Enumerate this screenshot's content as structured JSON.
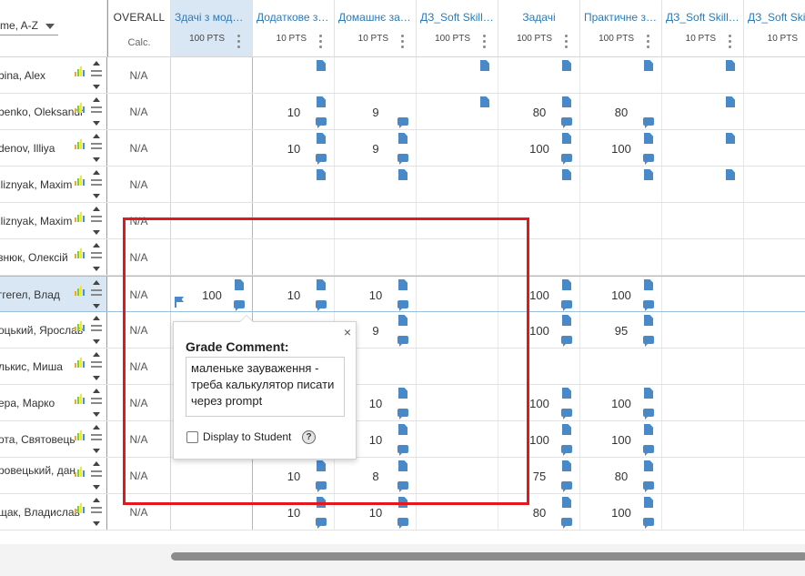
{
  "sort": {
    "label": "me, A-Z"
  },
  "overall": {
    "title": "OVERALL",
    "subtitle": "Calc."
  },
  "columns": [
    {
      "title": "Здачі з модул...",
      "pts": "100 PTS"
    },
    {
      "title": "Додаткове за...",
      "pts": "10 PTS"
    },
    {
      "title": "Домашнє зав...",
      "pts": "10 PTS"
    },
    {
      "title": "ДЗ_Soft Skills...",
      "pts": "100 PTS"
    },
    {
      "title": "Задачі",
      "pts": "100 PTS"
    },
    {
      "title": "Практичне за...",
      "pts": "100 PTS"
    },
    {
      "title": "ДЗ_Soft Skills...",
      "pts": "10 PTS"
    },
    {
      "title": "ДЗ_Soft Skills...",
      "pts": "10 PTS"
    }
  ],
  "students": [
    {
      "name": "bina, Alex",
      "overall": "N/A",
      "grades": [
        "",
        "",
        "",
        "",
        "",
        "",
        "",
        ""
      ]
    },
    {
      "name": "benko, Oleksandr",
      "overall": "N/A",
      "grades": [
        "",
        "10",
        "9",
        "",
        "80",
        "80",
        "",
        ""
      ]
    },
    {
      "name": "denov, Illiya",
      "overall": "N/A",
      "grades": [
        "",
        "10",
        "9",
        "",
        "100",
        "100",
        "",
        ""
      ]
    },
    {
      "name": "lliznyak, Maxim",
      "overall": "N/A",
      "grades": [
        "",
        "",
        "",
        "",
        "",
        "",
        "",
        ""
      ]
    },
    {
      "name": "lliznyak, Maxim",
      "overall": "N/A",
      "grades": [
        "",
        "",
        "",
        "",
        "",
        "",
        "",
        ""
      ]
    },
    {
      "name": "знюк, Олексій",
      "overall": "N/A",
      "grades": [
        "",
        "",
        "",
        "",
        "",
        "",
        "",
        ""
      ]
    },
    {
      "name": "ггегел, Влад",
      "overall": "N/A",
      "grades": [
        "100",
        "10",
        "10",
        "",
        "100",
        "100",
        "",
        ""
      ]
    },
    {
      "name": "оцький, Ярослав",
      "overall": "N/A",
      "grades": [
        "",
        "",
        "9",
        "",
        "100",
        "95",
        "",
        ""
      ]
    },
    {
      "name": "лькис, Миша",
      "overall": "N/A",
      "grades": [
        "",
        "",
        "",
        "",
        "",
        "",
        "",
        ""
      ]
    },
    {
      "name": "ера, Марко",
      "overall": "N/A",
      "grades": [
        "",
        "",
        "10",
        "",
        "100",
        "100",
        "",
        ""
      ]
    },
    {
      "name": "ота, Святовець",
      "overall": "N/A",
      "grades": [
        "",
        "",
        "10",
        "",
        "100",
        "100",
        "",
        ""
      ]
    },
    {
      "name": "ровецький, дан",
      "overall": "N/A",
      "grades": [
        "",
        "10",
        "8",
        "",
        "75",
        "80",
        "",
        ""
      ]
    },
    {
      "name": "щак, Владислав",
      "overall": "N/A",
      "grades": [
        "",
        "10",
        "10",
        "",
        "80",
        "100",
        "",
        ""
      ]
    }
  ],
  "popover": {
    "title": "Grade Comment:",
    "comment": "маленьке зауваження - треба калькулятор писати через prompt",
    "checkbox_label": "Display to Student",
    "help": "?",
    "close": "×"
  },
  "colors": {
    "link_blue": "#2a7ab8",
    "icon_blue": "#4a89c8",
    "selected_bg": "#d9e7f4",
    "annotation_red": "#e3181f"
  },
  "icons": {
    "doc": [
      [
        1,
        3,
        4,
        5,
        6
      ],
      [
        1,
        3,
        4,
        6
      ],
      [
        1,
        2,
        4,
        5,
        6
      ],
      [
        1,
        2,
        4,
        5,
        6
      ],
      [],
      [],
      [
        0,
        1,
        2,
        4,
        5
      ],
      [
        2,
        4,
        5
      ],
      [],
      [
        2,
        4,
        5
      ],
      [
        2,
        4,
        5
      ],
      [
        1,
        2,
        4,
        5
      ],
      [
        1,
        2,
        4,
        5
      ]
    ],
    "cmt": [
      [],
      [
        1,
        2,
        4,
        5
      ],
      [
        1,
        2,
        4,
        5
      ],
      [],
      [],
      [],
      [
        0,
        1,
        2,
        4,
        5
      ],
      [
        2,
        4,
        5
      ],
      [],
      [
        2,
        4,
        5
      ],
      [
        2,
        4,
        5
      ],
      [
        1,
        2,
        4,
        5
      ],
      [
        1,
        2,
        4,
        5
      ]
    ],
    "flag_row": 6
  }
}
